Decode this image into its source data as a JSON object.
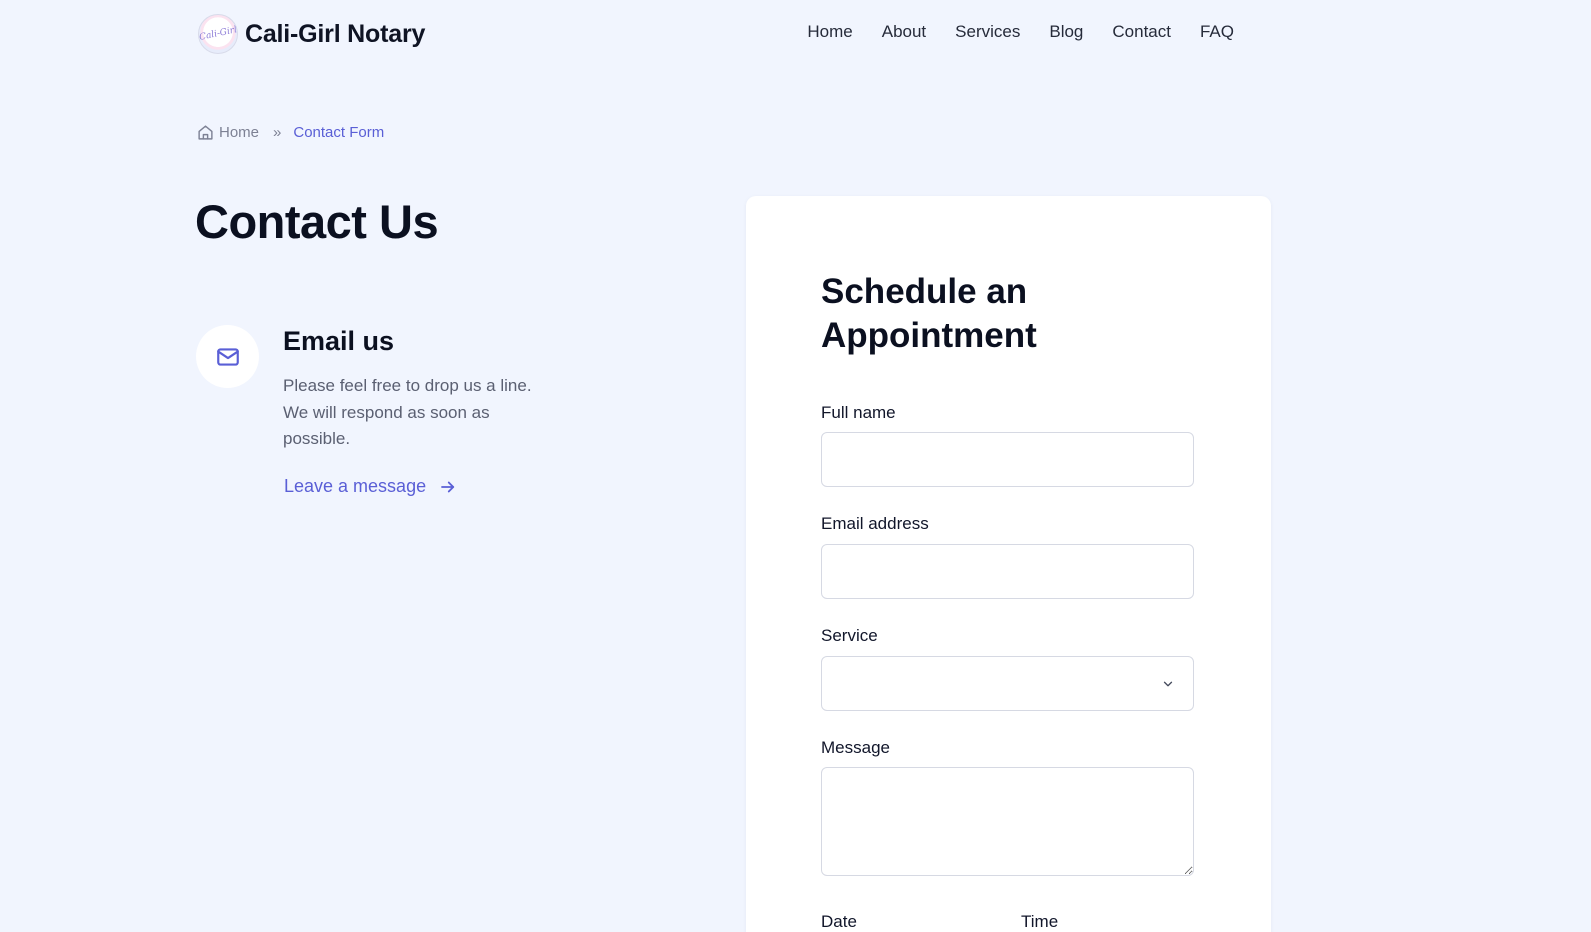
{
  "header": {
    "logo_text": "Cali-Girl",
    "brand": "Cali-Girl Notary",
    "nav": [
      "Home",
      "About",
      "Services",
      "Blog",
      "Contact",
      "FAQ"
    ]
  },
  "breadcrumb": {
    "home": "Home",
    "separator": "»",
    "current": "Contact Form"
  },
  "main": {
    "title": "Contact Us",
    "email": {
      "heading": "Email us",
      "description": "Please feel free to drop us a line. We will respond as soon as possible.",
      "link_label": "Leave a message"
    }
  },
  "form": {
    "title": "Schedule an Appointment",
    "full_name_label": "Full name",
    "full_name_value": "",
    "email_label": "Email address",
    "email_value": "",
    "service_label": "Service",
    "service_value": "",
    "message_label": "Message",
    "message_value": "",
    "date_label": "Date",
    "time_label": "Time"
  },
  "colors": {
    "background": "#f1f5fe",
    "accent": "#5a5fd6",
    "text": "#0b1020",
    "muted": "#5b6072"
  }
}
